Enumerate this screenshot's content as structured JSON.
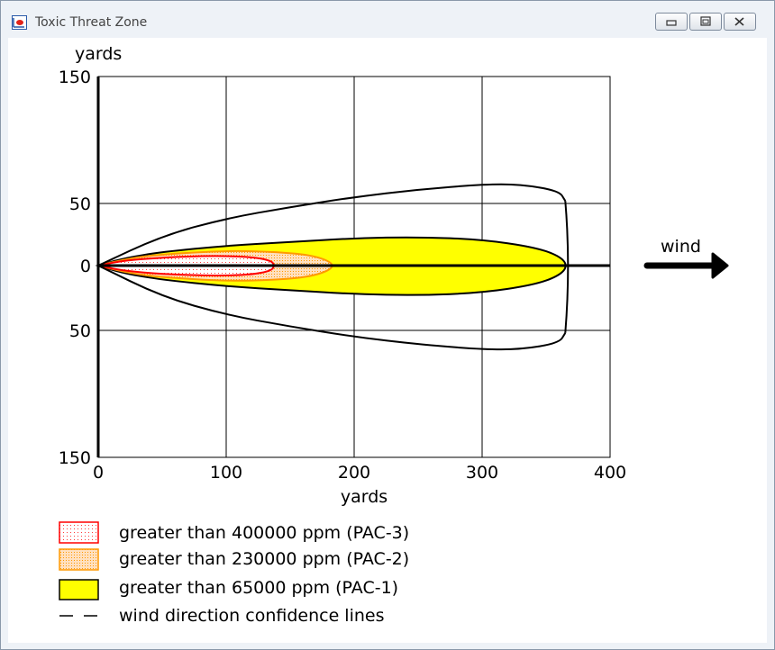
{
  "window": {
    "title": "Toxic Threat Zone",
    "icon": "threat-zone-app-icon",
    "buttons": [
      "minimize-icon",
      "restore-icon",
      "close-icon"
    ]
  },
  "chart_data": {
    "type": "area",
    "xlabel": "yards",
    "ylabel": "yards",
    "xlim": [
      0,
      400
    ],
    "ylim": [
      -150,
      150
    ],
    "x_ticks": [
      "0",
      "100",
      "200",
      "300",
      "400"
    ],
    "y_ticks": [
      "150",
      "50",
      "0",
      "50",
      "150"
    ],
    "y_tick_values": [
      150,
      50,
      0,
      -50,
      -150
    ],
    "grid": true,
    "wind_label": "wind",
    "series": [
      {
        "name": "greater than 65000 ppm (PAC-1)",
        "color": "#ffff00",
        "stroke": "#000000",
        "fill": "solid",
        "x": [
          0,
          20,
          50,
          100,
          150,
          200,
          250,
          300,
          340,
          360,
          367
        ],
        "half_width": [
          0,
          6,
          11,
          16,
          19,
          22,
          23,
          21,
          15,
          8,
          0
        ]
      },
      {
        "name": "greater than 230000 ppm (PAC-2)",
        "color": "#ffd9b3",
        "stroke": "#ff9900",
        "fill": "dotted",
        "x": [
          0,
          25,
          50,
          100,
          140,
          170,
          187
        ],
        "half_width": [
          0,
          6,
          9,
          12,
          11,
          8,
          0
        ]
      },
      {
        "name": "greater than 400000 ppm (PAC-3)",
        "color": "#ffffff",
        "stroke": "#ff0000",
        "fill": "dotted",
        "x": [
          0,
          20,
          50,
          90,
          120,
          135,
          138
        ],
        "half_width": [
          0,
          4,
          6.5,
          8,
          7,
          4,
          0
        ]
      },
      {
        "name": "wind direction confidence lines",
        "color": "#000000",
        "stroke": "#000000",
        "fill": "none",
        "x": [
          0,
          50,
          100,
          150,
          200,
          250,
          300,
          330,
          360,
          365
        ],
        "half_width": [
          0,
          24,
          38,
          47,
          55,
          61,
          65,
          65,
          60,
          52
        ]
      }
    ]
  },
  "legend": [
    {
      "label": "greater than 400000 ppm (PAC-3)"
    },
    {
      "label": "greater than 230000 ppm (PAC-2)"
    },
    {
      "label": "greater than 65000 ppm (PAC-1)"
    },
    {
      "label": "wind direction confidence lines"
    }
  ]
}
